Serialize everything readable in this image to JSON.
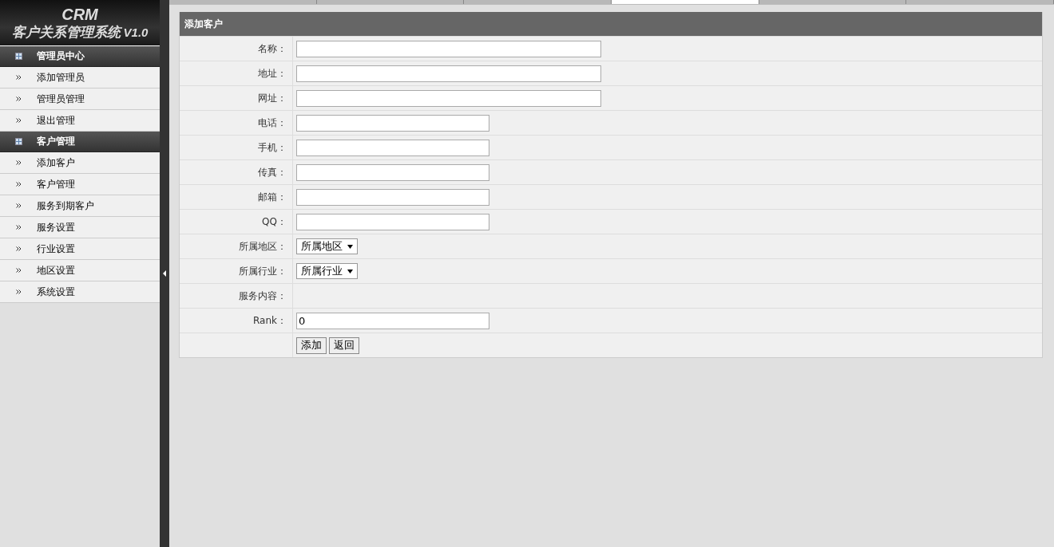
{
  "logo": {
    "title": "CRM",
    "subtitle": "客户关系管理系统",
    "version": "V1.0"
  },
  "tabs": [
    {
      "selected": false
    },
    {
      "selected": false
    },
    {
      "selected": false
    },
    {
      "selected": true
    },
    {
      "selected": false
    },
    {
      "selected": false
    }
  ],
  "sidebar": {
    "groups": [
      {
        "label": "管理员中心",
        "items": [
          "添加管理员",
          "管理员管理",
          "退出管理"
        ]
      },
      {
        "label": "客户管理",
        "items": [
          "添加客户",
          "客户管理",
          "服务到期客户",
          "服务设置",
          "行业设置",
          "地区设置",
          "系统设置"
        ]
      }
    ]
  },
  "form": {
    "title": "添加客户",
    "fields": [
      {
        "label": "名称：",
        "kind": "long_text"
      },
      {
        "label": "地址：",
        "kind": "long_text"
      },
      {
        "label": "网址：",
        "kind": "long_text"
      },
      {
        "label": "电话：",
        "kind": "text"
      },
      {
        "label": "手机：",
        "kind": "text"
      },
      {
        "label": "传真：",
        "kind": "text"
      },
      {
        "label": "邮箱：",
        "kind": "text"
      },
      {
        "label": "QQ：",
        "kind": "text"
      },
      {
        "label": "所属地区：",
        "kind": "select",
        "value": "所属地区"
      },
      {
        "label": "所属行业：",
        "kind": "select",
        "value": "所属行业"
      },
      {
        "label": "服务内容：",
        "kind": "static"
      },
      {
        "label": "Rank：",
        "kind": "text",
        "value": "0"
      }
    ],
    "buttons": [
      "添加",
      "返回"
    ]
  }
}
